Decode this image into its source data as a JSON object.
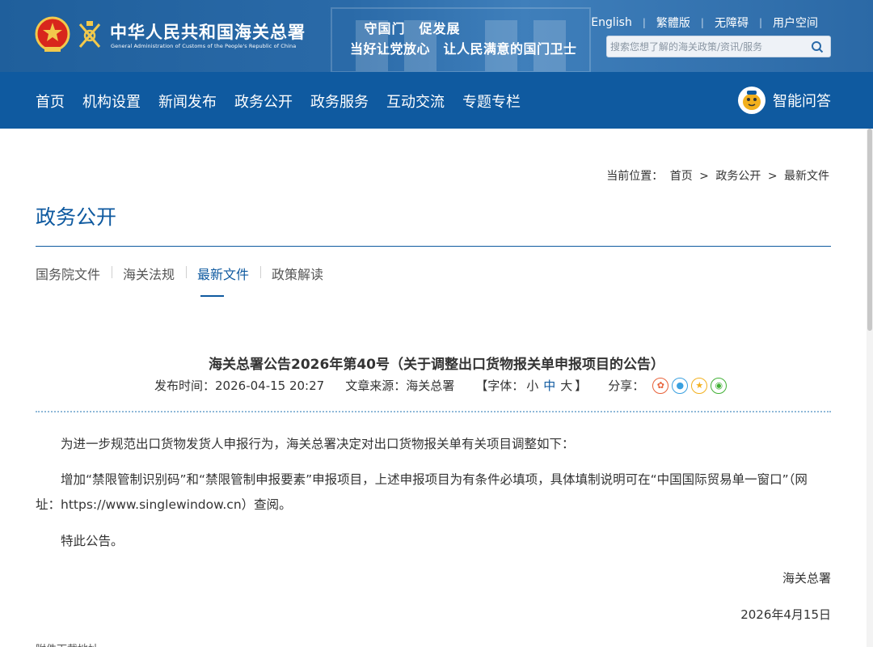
{
  "header": {
    "logo_cn": "中华人民共和国海关总署",
    "logo_en": "General Administration of Customs of the People's Republic of China",
    "slogan_line1": "守国门　促发展",
    "slogan_line2": "当好让党放心　让人民满意的国门卫士",
    "top_links": [
      "English",
      "繁體版",
      "无障碍",
      "用户空间"
    ],
    "search_placeholder": "搜索您想了解的海关政策/资讯/服务"
  },
  "nav": {
    "items": [
      "首页",
      "机构设置",
      "新闻发布",
      "政务公开",
      "政务服务",
      "互动交流",
      "专题专栏"
    ],
    "qa_label": "智能问答"
  },
  "breadcrumb": {
    "prefix": "当前位置：",
    "items": [
      "首页",
      "政务公开",
      "最新文件"
    ],
    "separator": ">"
  },
  "section": {
    "title": "政务公开",
    "tabs": [
      "国务院文件",
      "海关法规",
      "最新文件",
      "政策解读"
    ],
    "active_tab": "最新文件"
  },
  "article": {
    "title": "海关总署公告2026年第40号（关于调整出口货物报关单申报项目的公告）",
    "publish_label": "发布时间：",
    "publish_time": "2026-04-15 20:27",
    "source_label": "文章来源：",
    "source": "海关总署",
    "font_label_open": "【字体：",
    "font_small": "小",
    "font_medium": "中",
    "font_large": "大",
    "font_label_close": "】",
    "share_label": "分享：",
    "paragraphs": [
      "为进一步规范出口货物发货人申报行为，海关总署决定对出口货物报关单有关项目调整如下：",
      "增加“禁限管制识别码”和“禁限管制申报要素”申报项目，上述申报项目为有条件必填项，具体填制说明可在“中国国际贸易单一窗口”（网址：https://www.singlewindow.cn）查阅。",
      "特此公告。"
    ],
    "signature": "海关总署",
    "date": "2026年4月15日",
    "bottom_cut": "附件下载地址"
  },
  "colors": {
    "brand_blue": "#0f5aa0",
    "banner_blue": "#2a6aa8",
    "share_weibo": "#e8623a",
    "share_qq": "#3aa0e0",
    "share_qzone": "#f2b01e",
    "share_wechat": "#41b035"
  }
}
